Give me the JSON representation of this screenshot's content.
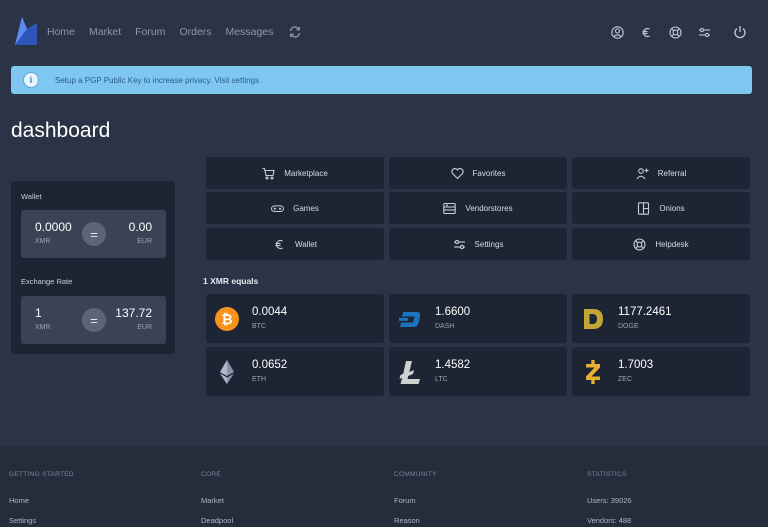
{
  "nav": {
    "links": [
      "Home",
      "Market",
      "Forum",
      "Orders",
      "Messages"
    ],
    "right_icons": [
      "user-circle-icon",
      "euro-icon",
      "lifebuoy-icon",
      "sliders-icon"
    ],
    "power_icon": "power-icon"
  },
  "alert": {
    "icon": "info-icon",
    "text": "Setup a PGP Public Key to increase privacy. Visit settings"
  },
  "page_title": "dashboard",
  "wallet": {
    "label": "Wallet",
    "left_value": "0.0000",
    "left_currency": "XMR",
    "right_value": "0.00",
    "right_currency": "EUR",
    "eq": "="
  },
  "exchange": {
    "label": "Exchange Rate",
    "left_value": "1",
    "left_currency": "XMR",
    "right_value": "137.72",
    "right_currency": "EUR",
    "eq": "="
  },
  "actions": [
    {
      "label": "Marketplace",
      "icon": "cart-icon"
    },
    {
      "label": "Favorites",
      "icon": "heart-icon"
    },
    {
      "label": "Referral",
      "icon": "user-plus-icon"
    },
    {
      "label": "Games",
      "icon": "gamepad-icon"
    },
    {
      "label": "Vendorstores",
      "icon": "store-icon"
    },
    {
      "label": "Onions",
      "icon": "onion-icon"
    },
    {
      "label": "Wallet",
      "icon": "euro-icon"
    },
    {
      "label": "Settings",
      "icon": "sliders-icon"
    },
    {
      "label": "Helpdesk",
      "icon": "lifebuoy-icon"
    }
  ],
  "rates_label": "1 XMR equals",
  "coins": [
    {
      "value": "0.0044",
      "symbol": "BTC",
      "color": "#f7931a"
    },
    {
      "value": "1.6600",
      "symbol": "DASH",
      "color": "#1c75bc"
    },
    {
      "value": "1177.2461",
      "symbol": "DOGE",
      "color": "#c2a633"
    },
    {
      "value": "0.0652",
      "symbol": "ETH",
      "color": "#8c8fa8"
    },
    {
      "value": "1.4582",
      "symbol": "LTC",
      "color": "#bfbfbf"
    },
    {
      "value": "1.7003",
      "symbol": "ZEC",
      "color": "#e8b030"
    }
  ],
  "footer": {
    "columns": [
      {
        "heading": "GETTING STARTED",
        "items": [
          "Home",
          "Settings"
        ]
      },
      {
        "heading": "CORE",
        "items": [
          "Market",
          "Deadpool"
        ]
      },
      {
        "heading": "COMMUNITY",
        "items": [
          "Forum",
          "Reason"
        ]
      },
      {
        "heading": "STATISTICS",
        "items": [
          "Users: 39026",
          "Vendors: 488"
        ]
      }
    ]
  }
}
